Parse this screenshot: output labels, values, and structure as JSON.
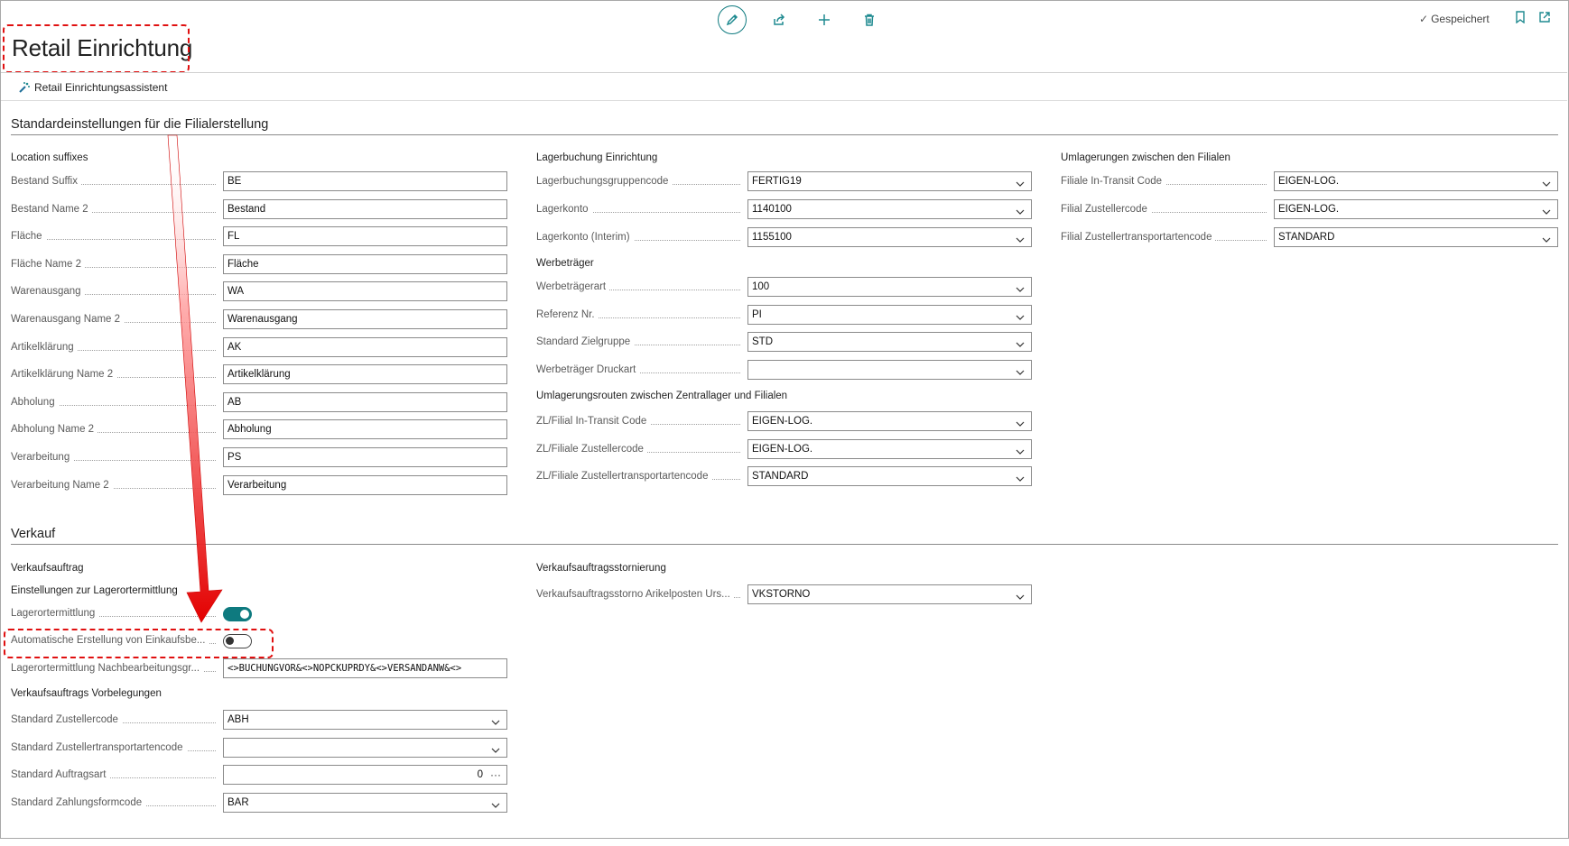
{
  "page": {
    "title": "Retail Einrichtung",
    "status": "Gespeichert"
  },
  "toolbar": {
    "icons": [
      "pencil-icon",
      "share-icon",
      "plus-icon",
      "trash-icon"
    ]
  },
  "actions": {
    "assistant_label": "Retail Einrichtungsassistent"
  },
  "sections": {
    "standard": "Standardeinstellungen für die Filialerstellung",
    "verkauf": "Verkauf"
  },
  "col1": {
    "group": "Location suffixes",
    "fields": [
      {
        "label": "Bestand Suffix",
        "value": "BE"
      },
      {
        "label": "Bestand Name 2",
        "value": "Bestand"
      },
      {
        "label": "Fläche",
        "value": "FL"
      },
      {
        "label": "Fläche Name 2",
        "value": "Fläche"
      },
      {
        "label": "Warenausgang",
        "value": "WA"
      },
      {
        "label": "Warenausgang Name 2",
        "value": "Warenausgang"
      },
      {
        "label": "Artikelklärung",
        "value": "AK"
      },
      {
        "label": "Artikelklärung Name 2",
        "value": "Artikelklärung"
      },
      {
        "label": "Abholung",
        "value": "AB"
      },
      {
        "label": "Abholung Name 2",
        "value": "Abholung"
      },
      {
        "label": "Verarbeitung",
        "value": "PS"
      },
      {
        "label": "Verarbeitung Name 2",
        "value": "Verarbeitung"
      }
    ]
  },
  "col2": {
    "group1": "Lagerbuchung Einrichtung",
    "fields1": [
      {
        "label": "Lagerbuchungsgruppencode",
        "value": "FERTIG19"
      },
      {
        "label": "Lagerkonto",
        "value": "1140100"
      },
      {
        "label": "Lagerkonto (Interim)",
        "value": "1155100"
      }
    ],
    "group2": "Werbeträger",
    "fields2": [
      {
        "label": "Werbeträgerart",
        "value": "100"
      },
      {
        "label": "Referenz Nr.",
        "value": "PI"
      },
      {
        "label": "Standard Zielgruppe",
        "value": "STD"
      },
      {
        "label": "Werbeträger Druckart",
        "value": ""
      }
    ],
    "group3": "Umlagerungsrouten zwischen Zentrallager und Filialen",
    "fields3": [
      {
        "label": "ZL/Filial In-Transit Code",
        "value": "EIGEN-LOG."
      },
      {
        "label": "ZL/Filiale Zustellercode",
        "value": "EIGEN-LOG."
      },
      {
        "label": "ZL/Filiale Zustellertransportartencode",
        "value": "STANDARD"
      }
    ]
  },
  "col3": {
    "group": "Umlagerungen zwischen den Filialen",
    "fields": [
      {
        "label": "Filiale In-Transit Code",
        "value": "EIGEN-LOG."
      },
      {
        "label": "Filial Zustellercode",
        "value": "EIGEN-LOG."
      },
      {
        "label": "Filial Zustellertransportartencode",
        "value": "STANDARD"
      }
    ]
  },
  "verkauf": {
    "group1": "Verkaufsauftrag",
    "group2": "Einstellungen zur Lagerortermittlung",
    "lagerortermittlung": {
      "label": "Lagerortermittlung",
      "on": true
    },
    "auto_einkauf": {
      "label": "Automatische Erstellung von Einkaufsbe...",
      "on": false
    },
    "nachbearbeitung": {
      "label": "Lagerortermittlung Nachbearbeitungsgr...",
      "value": "<>BUCHUNGVOR&<>NOPCKUPRDY&<>VERSANDANW&<>"
    },
    "group3": "Verkaufsauftrags Vorbelegungen",
    "fields": [
      {
        "label": "Standard Zustellercode",
        "value": "ABH"
      },
      {
        "label": "Standard Zustellertransportartencode",
        "value": ""
      },
      {
        "label": "Standard Auftragsart",
        "value": "0"
      },
      {
        "label": "Standard Zahlungsformcode",
        "value": "BAR"
      }
    ],
    "storno_group": "Verkaufsauftragsstornierung",
    "storno": {
      "label": "Verkaufsauftragsstorno Arikelposten Urs...",
      "value": "VKSTORNO"
    }
  }
}
